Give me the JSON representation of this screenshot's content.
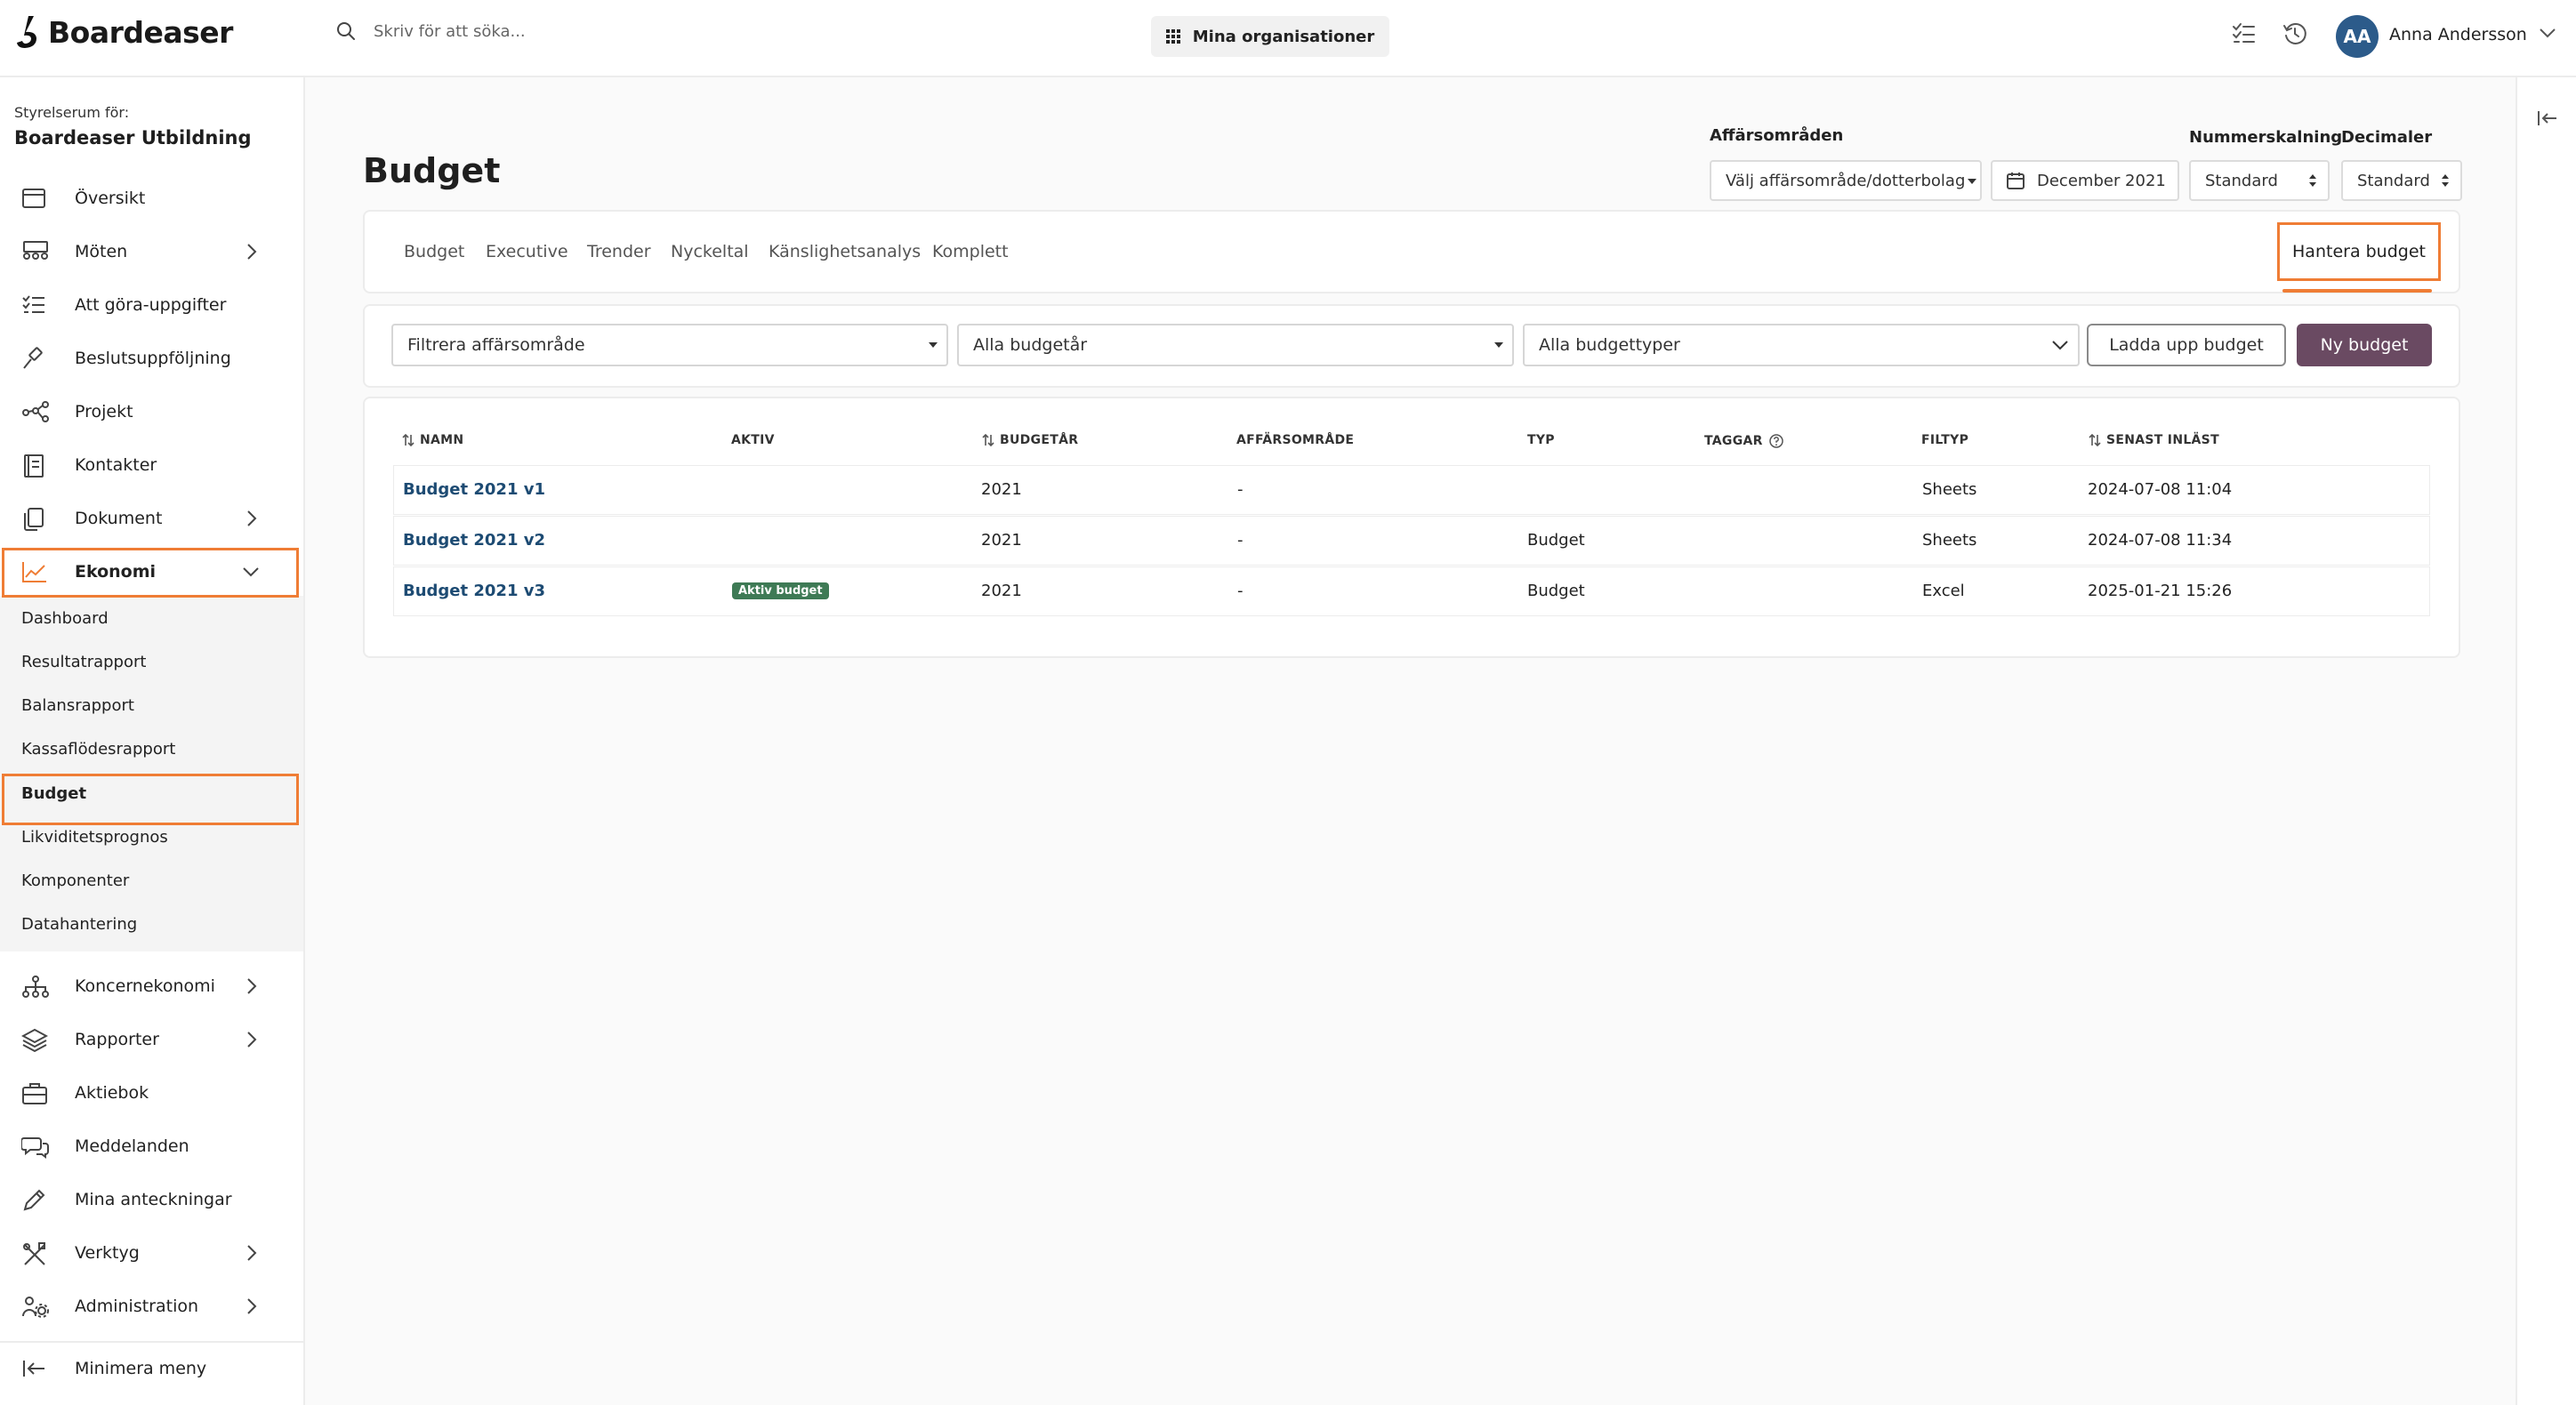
{
  "app": {
    "name": "Boardeaser"
  },
  "header": {
    "search_placeholder": "Skriv för att söka...",
    "org_button": "Mina organisationer",
    "user_initials": "AA",
    "user_name": "Anna Andersson"
  },
  "sidebar": {
    "caption": "Styrelserum för:",
    "org_name": "Boardeaser Utbildning",
    "items": [
      {
        "label": "Översikt",
        "icon": "calendar-icon"
      },
      {
        "label": "Möten",
        "icon": "meeting-icon",
        "has_children": true
      },
      {
        "label": "Att göra-uppgifter",
        "icon": "checklist-icon"
      },
      {
        "label": "Beslutsuppföljning",
        "icon": "gavel-icon"
      },
      {
        "label": "Projekt",
        "icon": "network-icon"
      },
      {
        "label": "Kontakter",
        "icon": "contacts-icon"
      },
      {
        "label": "Dokument",
        "icon": "documents-icon",
        "has_children": true
      },
      {
        "label": "Ekonomi",
        "icon": "chart-icon",
        "expanded": true
      }
    ],
    "ekonomi_sub": [
      "Dashboard",
      "Resultatrapport",
      "Balansrapport",
      "Kassaflödesrapport",
      "Budget",
      "Likviditetsprognos",
      "Komponenter",
      "Datahantering"
    ],
    "active_sub": "Budget",
    "items_after": [
      {
        "label": "Koncernekonomi",
        "icon": "hierarchy-icon",
        "has_children": true
      },
      {
        "label": "Rapporter",
        "icon": "layers-icon",
        "has_children": true
      },
      {
        "label": "Aktiebok",
        "icon": "briefcase-icon"
      },
      {
        "label": "Meddelanden",
        "icon": "chat-icon"
      },
      {
        "label": "Mina anteckningar",
        "icon": "pencil-icon"
      },
      {
        "label": "Verktyg",
        "icon": "tools-icon",
        "has_children": true
      },
      {
        "label": "Administration",
        "icon": "users-gear-icon",
        "has_children": true
      }
    ],
    "minimize": "Minimera meny"
  },
  "page": {
    "title": "Budget",
    "filters": {
      "area_label": "Affärsområden",
      "area_value": "Välj affärsområde/dotterbolag",
      "date_value": "December 2021",
      "scale_label": "Nummerskalning",
      "scale_value": "Standard",
      "decimals_label": "Decimaler",
      "decimals_value": "Standard"
    },
    "tabs": [
      "Budget",
      "Executive",
      "Trender",
      "Nyckeltal",
      "Känslighetsanalys",
      "Komplett"
    ],
    "manage_tab": "Hantera budget",
    "toolbar": {
      "area_filter": "Filtrera affärsområde",
      "year_filter": "Alla budgetår",
      "type_filter": "Alla budgettyper",
      "upload_button": "Ladda upp budget",
      "new_button": "Ny budget"
    },
    "table": {
      "headers": {
        "name": "NAMN",
        "active": "AKTIV",
        "year": "BUDGETÅR",
        "area": "AFFÄRSOMRÅDE",
        "type": "TYP",
        "tags": "TAGGAR",
        "filetype": "FILTYP",
        "loaded": "SENAST INLÄST"
      },
      "rows": [
        {
          "name": "Budget 2021 v1",
          "active": "",
          "year": "2021",
          "area": "-",
          "type": "",
          "filetype": "Sheets",
          "loaded": "2024-07-08 11:04"
        },
        {
          "name": "Budget 2021 v2",
          "active": "",
          "year": "2021",
          "area": "-",
          "type": "Budget",
          "filetype": "Sheets",
          "loaded": "2024-07-08 11:34"
        },
        {
          "name": "Budget 2021 v3",
          "active": "Aktiv budget",
          "year": "2021",
          "area": "-",
          "type": "Budget",
          "filetype": "Excel",
          "loaded": "2025-01-21 15:26"
        }
      ]
    }
  },
  "colors": {
    "accent": "#ef7d35",
    "primary_button": "#6a4a62",
    "link": "#1d4b73",
    "avatar": "#2c5b8a",
    "badge": "#3e7a55"
  }
}
